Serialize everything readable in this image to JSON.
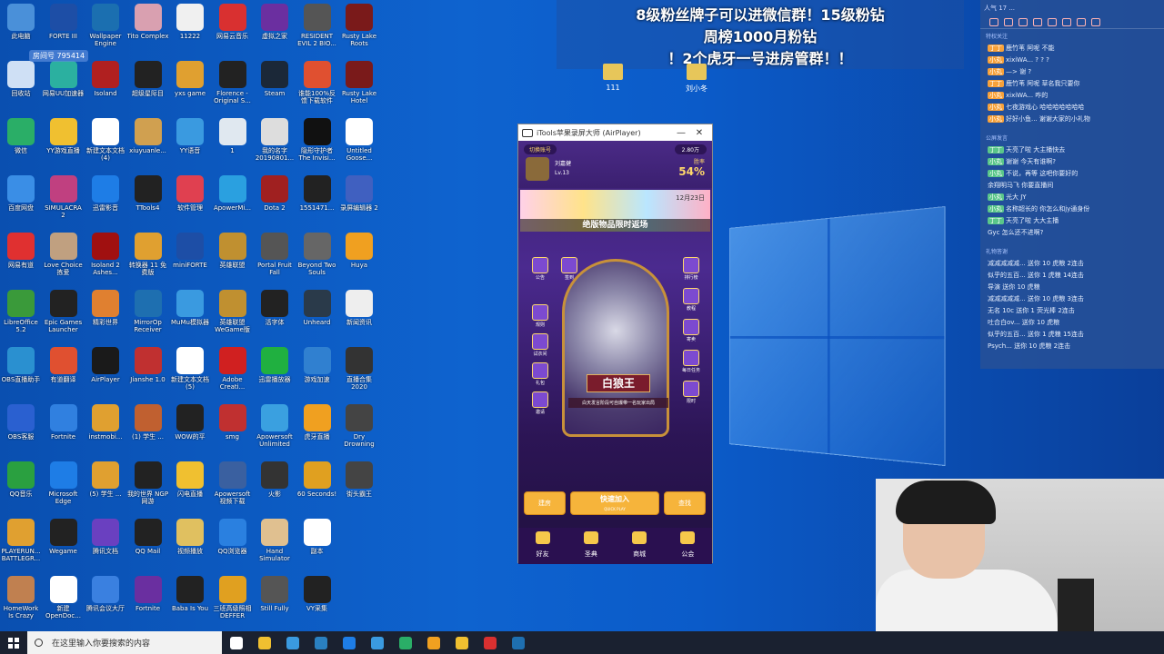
{
  "desktop": {
    "icons": [
      [
        "此电脑",
        "#4a90d9"
      ],
      [
        "FORTE III",
        "#1d4ea6"
      ],
      [
        "Wallpaper Engine",
        "#1b6fb0"
      ],
      [
        "Tito Complex",
        "#d9a0b0"
      ],
      [
        "11222",
        "#f0f0f0"
      ],
      [
        "网易云音乐",
        "#d93030"
      ],
      [
        "虚拟之家",
        "#6b2fa0"
      ],
      [
        "RESIDENT EVIL 2 BIO...",
        "#555"
      ],
      [
        "Rusty Lake Roots",
        "#7a1a1a"
      ],
      [
        "回收站",
        "#cfe0f5"
      ],
      [
        "网易UU加速器",
        "#2bb0a0"
      ],
      [
        "Isoland",
        "#b02020"
      ],
      [
        "超级星际目",
        "#222"
      ],
      [
        "yxs game",
        "#e0a030"
      ],
      [
        "Florence - Original S...",
        "#222"
      ],
      [
        "Steam",
        "#1b2838"
      ],
      [
        "谁能100%反馈下载软件",
        "#e05030"
      ],
      [
        "Rusty Lake Hotel",
        "#7a1a1a"
      ],
      [
        "微信",
        "#2aae67"
      ],
      [
        "YY游戏直播",
        "#f0c030"
      ],
      [
        "新建文本文档 (4)",
        "#fff"
      ],
      [
        "xiuyuanle...",
        "#d0a050"
      ],
      [
        "YY语音",
        "#3a9ae0"
      ],
      [
        "1",
        "#e0e8f0"
      ],
      [
        "我的名字 20190801...",
        "#ddd"
      ],
      [
        "隐形守护者 The Invisi...",
        "#111"
      ],
      [
        "Untitled Goose...",
        "#fff"
      ],
      [
        "百度网盘",
        "#3a8ee6"
      ],
      [
        "SIMULACRA 2",
        "#c04080"
      ],
      [
        "迅雷影音",
        "#1e7de6"
      ],
      [
        "TTools4",
        "#222"
      ],
      [
        "软件管理",
        "#e04050"
      ],
      [
        "ApowerMi...",
        "#2aa0e0"
      ],
      [
        "Dota 2",
        "#a02020"
      ],
      [
        "1551471...",
        "#222"
      ],
      [
        "录屏编辑器 2",
        "#4060c0"
      ],
      [
        "网易有道",
        "#e03030"
      ],
      [
        "Love Choice 拣爱",
        "#c0a080"
      ],
      [
        "Isoland 2 Ashes...",
        "#a01010"
      ],
      [
        "转换器 11 免费版",
        "#e0a030"
      ],
      [
        "miniFORTE",
        "#1d4ea6"
      ],
      [
        "英雄联盟",
        "#c09030"
      ],
      [
        "Portal Fruit Fall",
        "#555"
      ],
      [
        "Beyond Two Souls",
        "#666"
      ],
      [
        "Huya",
        "#f0a020"
      ],
      [
        "LibreOffice 5.2",
        "#3a9a3a"
      ],
      [
        "Epic Games Launcher",
        "#222"
      ],
      [
        "精彩世界",
        "#e08030"
      ],
      [
        "MirrorOp Receiver",
        "#1e6fb0"
      ],
      [
        "MuMu模拟器",
        "#3a9ae0"
      ],
      [
        "英雄联盟 WeGame版",
        "#c09030"
      ],
      [
        "活字体",
        "#222"
      ],
      [
        "Unheard",
        "#2a3a4a"
      ],
      [
        "新闻资讯",
        "#eee"
      ],
      [
        "OBS直播助手",
        "#2a90d0"
      ],
      [
        "有道翻译",
        "#e05030"
      ],
      [
        "AirPlayer",
        "#1a1a1a"
      ],
      [
        "Jianshe 1.0",
        "#c03030"
      ],
      [
        "新建文本文档 (5)",
        "#fff"
      ],
      [
        "Adobe Creati...",
        "#d02020"
      ],
      [
        "迅雷播放器",
        "#20b040"
      ],
      [
        "游戏加速",
        "#3080d0"
      ],
      [
        "直播合集 2020",
        "#333"
      ],
      [
        "OBS客服",
        "#2a60d0"
      ],
      [
        "Fortnite",
        "#3080e0"
      ],
      [
        "instmobi...",
        "#e0a030"
      ],
      [
        "(1) 学生 ...",
        "#c06030"
      ],
      [
        "WOW的平",
        "#222"
      ],
      [
        "smg",
        "#c03030"
      ],
      [
        "Apowersoft Unlimited",
        "#3aa0e0"
      ],
      [
        "虎牙直播",
        "#f0a020"
      ],
      [
        "Dry Drowning",
        "#444"
      ],
      [
        "QQ音乐",
        "#2aa040"
      ],
      [
        "Microsoft Edge",
        "#1e7de6"
      ],
      [
        "(5) 学生 ...",
        "#e0a030"
      ],
      [
        "我的世界 NGP网游",
        "#222"
      ],
      [
        "闪电直播",
        "#f0c030"
      ],
      [
        "Apowersoft 视频下载",
        "#3a60a0"
      ],
      [
        "火影",
        "#333"
      ],
      [
        "60 Seconds!",
        "#e0a020"
      ],
      [
        "街头霸王",
        "#444"
      ],
      [
        "PLAYERUN... BATTLEGR...",
        "#e0a030"
      ],
      [
        "Wegame",
        "#222"
      ],
      [
        "腾讯文档",
        "#6a40c0"
      ],
      [
        "QQ Mail",
        "#222"
      ],
      [
        "视频播放",
        "#e0c060"
      ],
      [
        "QQ浏览器",
        "#2a80e0"
      ],
      [
        "Hand Simulator",
        "#e0c090"
      ],
      [
        "副本",
        "#fff"
      ],
      [
        "",
        ""
      ],
      [
        "HomeWork Is Crazy",
        "#c08050"
      ],
      [
        "新建 OpenDoc...",
        "#fff"
      ],
      [
        "腾讯会议大厅",
        "#3a80e0"
      ],
      [
        "Fortnite",
        "#6a2fa0"
      ],
      [
        "Baba Is You",
        "#222"
      ],
      [
        "三班高级照相 DEFFER",
        "#e0a020"
      ],
      [
        "Still Fully",
        "#555"
      ],
      [
        "VY采集",
        "#222"
      ],
      [
        "",
        ""
      ]
    ]
  },
  "room": {
    "label": "房间号",
    "value": "795414"
  },
  "banner": {
    "line1": "8级粉丝牌子可以进微信群！15级粉钻",
    "line2": "周榜1000月粉钻",
    "line3": "！2个虎牙一号进房管群！！"
  },
  "folders": [
    {
      "label": "111"
    },
    {
      "label": "刘小冬"
    }
  ],
  "chat": {
    "header": "人气 17 ...",
    "section_fans": "特权关注",
    "messages": [
      {
        "badge": "丁丁",
        "text": "鹿竹苇 阿呢 不能"
      },
      {
        "badge": "小丸",
        "text": "xixiWA... ? ? ?"
      },
      {
        "badge": "小丸",
        "text": "—> 谢 ?"
      },
      {
        "badge": "丁丁",
        "text": "鹿竹苇 阿呢 草名我只要你"
      },
      {
        "badge": "小丸",
        "text": "xixiWA... 咋的"
      },
      {
        "badge": "小丸",
        "text": "七夜游戏心 哈哈哈哈哈哈哈"
      },
      {
        "badge": "小丸",
        "text": "好好小鱼... 谢谢大家的小礼物"
      }
    ],
    "section_live": "公屏发言",
    "live": [
      {
        "name": "丁丁",
        "text": "天亮了啦 大主播快去"
      },
      {
        "name": "小丸",
        "text": "谢谢 今天有谁啊?"
      },
      {
        "name": "小丸",
        "text": "不说，再等 这吧你要好的"
      },
      {
        "name": "",
        "text": "余翔明马飞 你要直播间"
      },
      {
        "name": "小丸",
        "text": "光大 JY"
      },
      {
        "name": "小丸",
        "text": "名称超长的 你怎么和jy通身份"
      },
      {
        "name": "丁丁",
        "text": "天亮了啦 大大主播"
      },
      {
        "name": "",
        "text": "Gyc 怎么还不进啊?"
      }
    ],
    "section_gifts": "礼物答谢",
    "gifts": [
      "减减减减减... 送你 10 虎粮 2连击",
      "似乎的五百... 送你 1 虎粮 14连击",
      "导演 送你 10 虎粮",
      "减减减减减... 送你 10 虎粮 3连击",
      "无名 10c 送你 1 荧光棒 2连击",
      "吐合白ov... 送你 10 虎粮",
      "似乎的五百... 送你 1 虎粮 15连击",
      "Psych... 送你 10 虎粮 2连击"
    ]
  },
  "window": {
    "title": "iTools苹果录屏大师 (AirPlayer)",
    "minimize": "—",
    "close": "✕"
  },
  "game": {
    "top_left": "切换账号",
    "diamonds": "2.80万",
    "username": "刘嘉健",
    "level": "Lv.13",
    "winrate_label": "胜率",
    "winrate": "54%",
    "event_text": "绝版物品限时返场",
    "event_date": "12月23日",
    "side_left": [
      "公告",
      "签到",
      "规则",
      "试衣间",
      "礼包",
      "邀请"
    ],
    "side_right": [
      "排行榜",
      "教程",
      "寄卖",
      "每日任务",
      "限时"
    ],
    "role_name": "白狼王",
    "role_desc": "白天发言阶段可自爆带一名玩家出局",
    "btn_create": "建房",
    "btn_quick": "快速加入",
    "btn_quick_sub": "QUICK PLAY",
    "btn_find": "查找",
    "nav": [
      "好友",
      "圣典",
      "商城",
      "公会"
    ]
  },
  "taskbar": {
    "search_placeholder": "在这里输入你要搜索的内容",
    "apps": [
      "#fff",
      "#f0c030",
      "#3a9ae0",
      "#2a80c0",
      "#1e7de6",
      "#3a9ae0",
      "#2aae67",
      "#f0a020",
      "#f0c030",
      "#d93030",
      "#1e6fb0"
    ]
  }
}
